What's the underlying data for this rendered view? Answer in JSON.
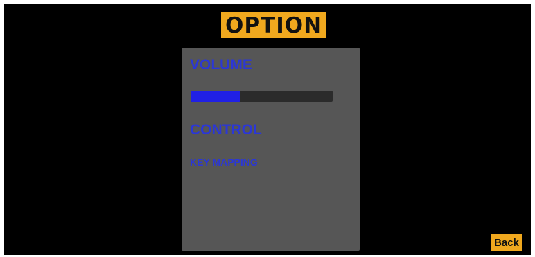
{
  "screen": {
    "title": "OPTION"
  },
  "options_panel": {
    "volume": {
      "label": "VOLUME",
      "level": 0.35
    },
    "control": {
      "label": "CONTROL",
      "key_mapping_label": "KEY MAPPING"
    }
  },
  "navigation": {
    "back_label": "Back"
  },
  "colors": {
    "background": "#000000",
    "accent": "#f0a81e",
    "panel": "#565656",
    "label_text": "#2b37d6",
    "slider_fill": "#2020e6",
    "slider_track": "#2b2b2b"
  }
}
